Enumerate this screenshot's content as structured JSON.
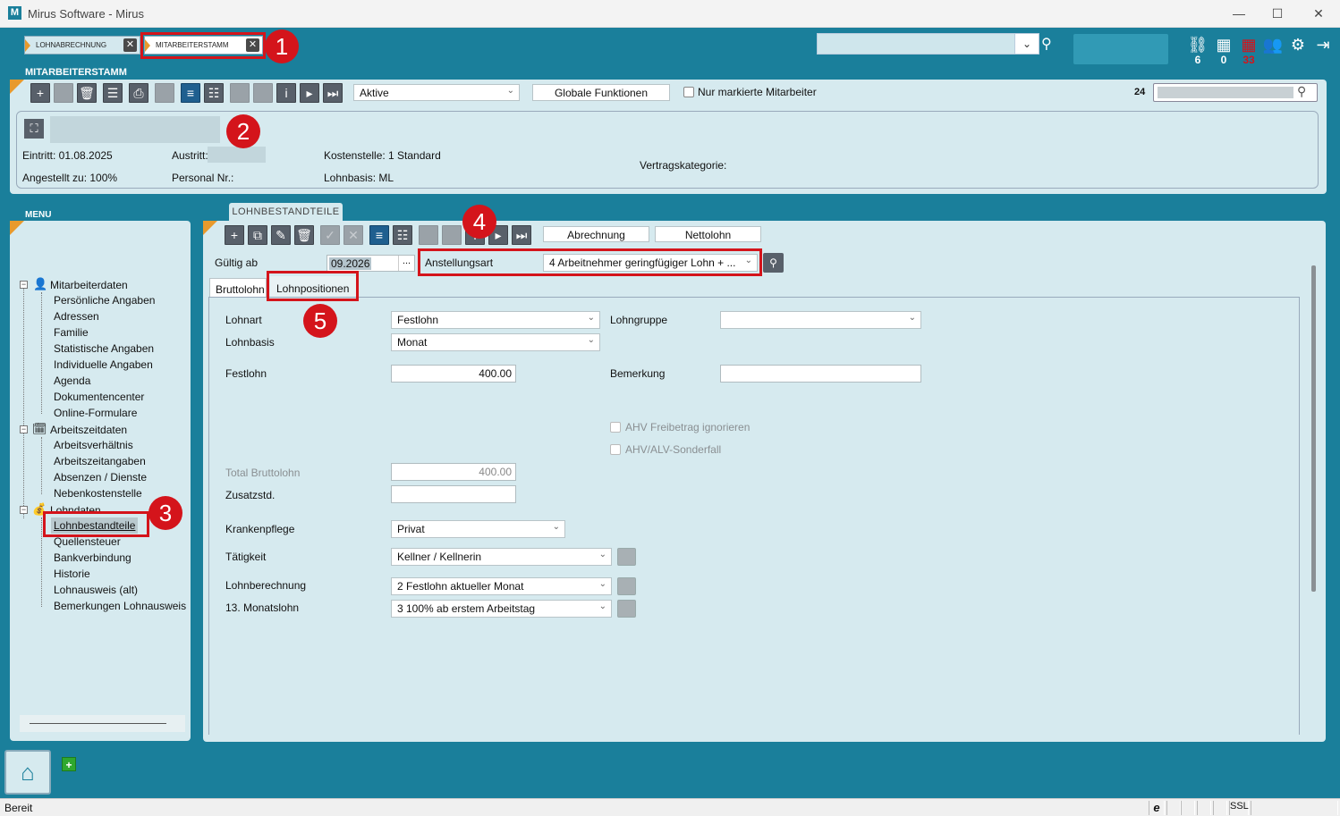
{
  "window": {
    "title": "Mirus Software - Mirus",
    "logo_letter": "M"
  },
  "doc_tabs": [
    {
      "label": "LOHNABRECHNUNG",
      "active": false
    },
    {
      "label": "MITARBEITERSTAMM",
      "active": true
    }
  ],
  "top_counts": {
    "tasks": "6",
    "calendar": "0",
    "reminders": "33"
  },
  "header": {
    "label": "MITARBEITERSTAMM"
  },
  "toolbar1": {
    "filter_value": "Aktive",
    "global_btn": "Globale Funktionen",
    "only_marked_label": "Nur markierte Mitarbeiter",
    "count": "24"
  },
  "employee": {
    "eintritt": "Eintritt: 01.08.2025",
    "austritt_label": "Austritt:",
    "kostenstelle": "Kostenstelle: 1 Standard",
    "angestellt": "Angestellt zu: 100%",
    "personal_nr_label": "Personal Nr.:",
    "lohnbasis": "Lohnbasis: ML",
    "vertragskategorie_label": "Vertragskategorie:"
  },
  "menu": {
    "label": "MENU",
    "groups": [
      {
        "label": "Mitarbeiterdaten",
        "items": [
          "Persönliche Angaben",
          "Adressen",
          "Familie",
          "Statistische Angaben",
          "Individuelle Angaben",
          "Agenda",
          "Dokumentencenter",
          "Online-Formulare"
        ]
      },
      {
        "label": "Arbeitszeitdaten",
        "items": [
          "Arbeitsverhältnis",
          "Arbeitszeitangaben",
          "Absenzen / Dienste",
          "Nebenkostenstelle"
        ]
      },
      {
        "label": "Lohndaten",
        "items": [
          "Lohnbestandteile",
          "Quellensteuer",
          "Bankverbindung",
          "Historie",
          "Lohnausweis (alt)",
          "Bemerkungen Lohnausweis"
        ]
      }
    ],
    "selected": "Lohnbestandteile"
  },
  "content": {
    "tab_label": "LOHNBESTANDTEILE",
    "abrechnung_btn": "Abrechnung",
    "nettolohn_btn": "Nettolohn",
    "gueltig_ab_label": "Gültig ab",
    "gueltig_ab_value": "09.2026",
    "anstellungsart_label": "Anstellungsart",
    "anstellungsart_value": "4 Arbeitnehmer geringfügiger Lohn + ...",
    "subtabs": [
      "Bruttolohn",
      "Lohnpositionen"
    ],
    "lohnart_label": "Lohnart",
    "lohnart_value": "Festlohn",
    "lohnbasis_label": "Lohnbasis",
    "lohnbasis_value": "Monat",
    "festlohn_label": "Festlohn",
    "festlohn_value": "400.00",
    "lohngruppe_label": "Lohngruppe",
    "lohngruppe_value": "",
    "bemerkung_label": "Bemerkung",
    "bemerkung_value": "",
    "ahv_freibetrag": "AHV Freibetrag ignorieren",
    "ahv_sonderfall": "AHV/ALV-Sonderfall",
    "total_bruttolohn_label": "Total Bruttolohn",
    "total_bruttolohn_value": "400.00",
    "zusatzstd_label": "Zusatzstd.",
    "zusatzstd_value": "",
    "krankenpflege_label": "Krankenpflege",
    "krankenpflege_value": "Privat",
    "taetigkeit_label": "Tätigkeit",
    "taetigkeit_value": "Kellner / Kellnerin",
    "lohnberechnung_label": "Lohnberechnung",
    "lohnberechnung_value": "2 Festlohn aktueller Monat",
    "monatslohn13_label": "13. Monatslohn",
    "monatslohn13_value": "3 100% ab erstem Arbeitstag"
  },
  "annotations": [
    "1",
    "2",
    "3",
    "4",
    "5"
  ],
  "status": {
    "text": "Bereit",
    "ssl": "SSL",
    "ie": "e"
  },
  "colors": {
    "teal": "#1a7f9b",
    "panel": "#d6eaef",
    "orange": "#e89a2c",
    "red": "#d4141b"
  }
}
